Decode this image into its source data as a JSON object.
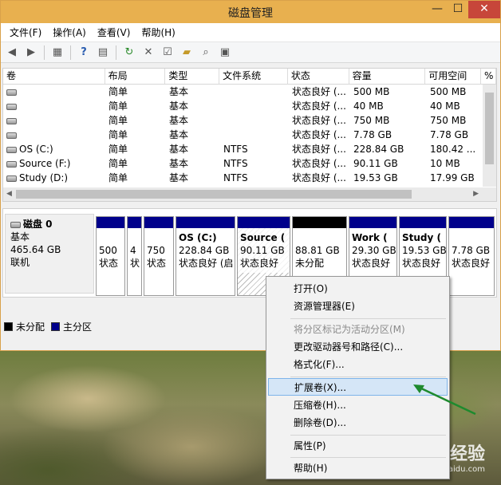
{
  "window": {
    "title": "磁盘管理",
    "min_glyph": "—",
    "max_glyph": "☐",
    "close_glyph": "✕"
  },
  "menu": [
    "文件(F)",
    "操作(A)",
    "查看(V)",
    "帮助(H)"
  ],
  "table": {
    "headers": [
      "卷",
      "布局",
      "类型",
      "文件系统",
      "状态",
      "容量",
      "可用空间",
      "%"
    ],
    "rows": [
      [
        "",
        "简单",
        "基本",
        "",
        "状态良好 (...",
        "500 MB",
        "500 MB"
      ],
      [
        "",
        "简单",
        "基本",
        "",
        "状态良好 (...",
        "40 MB",
        "40 MB"
      ],
      [
        "",
        "简单",
        "基本",
        "",
        "状态良好 (...",
        "750 MB",
        "750 MB"
      ],
      [
        "",
        "简单",
        "基本",
        "",
        "状态良好 (...",
        "7.78 GB",
        "7.78 GB"
      ],
      [
        "OS (C:)",
        "简单",
        "基本",
        "NTFS",
        "状态良好 (...",
        "228.84 GB",
        "180.42 ..."
      ],
      [
        "Source (F:)",
        "简单",
        "基本",
        "NTFS",
        "状态良好 (...",
        "90.11 GB",
        "10 MB"
      ],
      [
        "Study (D:)",
        "简单",
        "基本",
        "NTFS",
        "状态良好 (...",
        "19.53 GB",
        "17.99 GB"
      ]
    ]
  },
  "disk": {
    "name": "磁盘 0",
    "type": "基本",
    "size": "465.64 GB",
    "status": "联机"
  },
  "partitions": [
    {
      "l1": "",
      "l2": "500",
      "l3": "状态"
    },
    {
      "l1": "",
      "l2": "4",
      "l3": "状"
    },
    {
      "l1": "",
      "l2": "750",
      "l3": "状态"
    },
    {
      "l1": "OS  (C:)",
      "l2": "228.84 GB",
      "l3": "状态良好 (启"
    },
    {
      "l1": "Source  (",
      "l2": "90.11 GB",
      "l3": "状态良好"
    },
    {
      "l1": "",
      "l2": "88.81 GB",
      "l3": "未分配"
    },
    {
      "l1": "Work  (",
      "l2": "29.30 GB",
      "l3": "状态良好"
    },
    {
      "l1": "Study  (",
      "l2": "19.53 GB",
      "l3": "状态良好"
    },
    {
      "l1": "",
      "l2": "7.78 GB",
      "l3": "状态良好"
    }
  ],
  "legend": {
    "unallocated": "未分配",
    "primary": "主分区"
  },
  "context_menu": {
    "open": "打开(O)",
    "explorer": "资源管理器(E)",
    "mark_active": "将分区标记为活动分区(M)",
    "change_letter": "更改驱动器号和路径(C)...",
    "format": "格式化(F)...",
    "extend": "扩展卷(X)...",
    "shrink": "压缩卷(H)...",
    "delete": "删除卷(D)...",
    "properties": "属性(P)",
    "help": "帮助(H)"
  },
  "watermark": {
    "brand": "Baidu 经验",
    "url": "jingyan.baidu.com"
  },
  "colors": {
    "titlebar": "#e8b04f",
    "primary_partition": "#00008b",
    "unallocated": "#000000",
    "highlight": "#d5e6f7",
    "arrow": "#1e8a2e"
  }
}
